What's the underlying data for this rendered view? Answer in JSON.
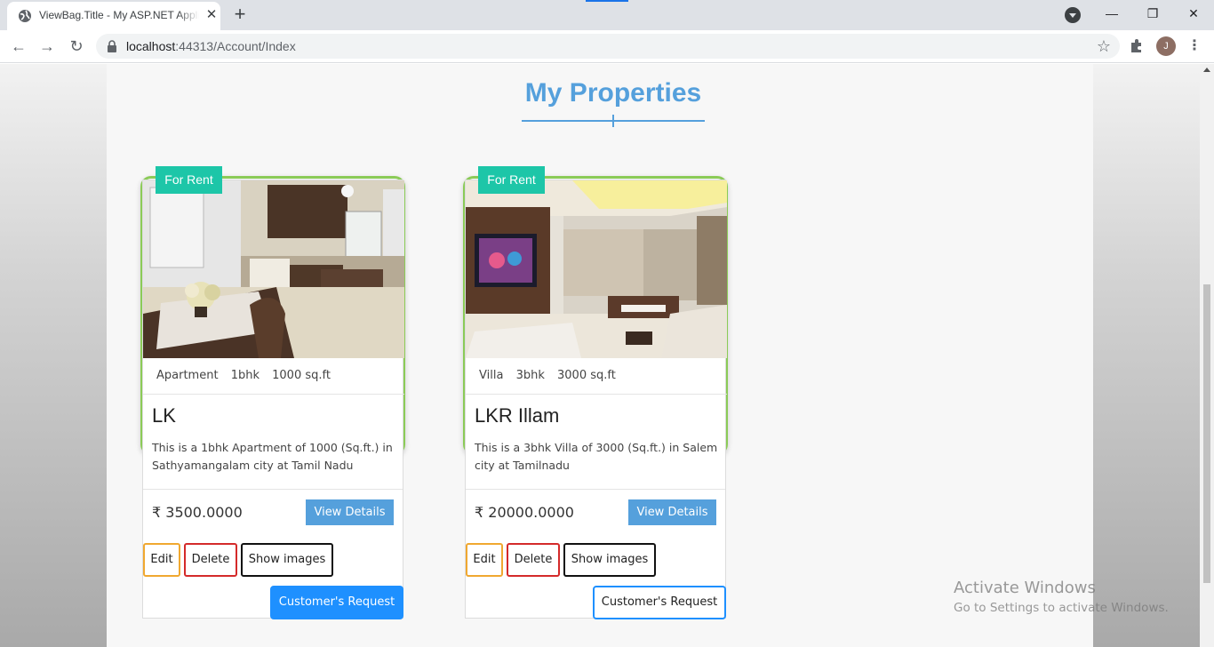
{
  "browser": {
    "tab_title": "ViewBag.Title - My ASP.NET Application",
    "tab_close": "✕",
    "new_tab": "+",
    "url_host": "localhost",
    "url_path": ":44313/Account/Index",
    "avatar_letter": "J",
    "window": {
      "minimize": "—",
      "restore": "❐",
      "close": "✕"
    },
    "nav": {
      "back": "←",
      "forward": "→",
      "reload": "↻"
    },
    "star": "☆",
    "menu": "⋮"
  },
  "page": {
    "title": "My Properties",
    "accent_color": "#55a0dc"
  },
  "properties": [
    {
      "badge": "For Rent",
      "type": "Apartment",
      "bhk": "1bhk",
      "area": "1000 sq.ft",
      "name": "LK",
      "description": "This is a 1bhk Apartment of 1000 (Sq.ft.) in Sathyamangalam city at Tamil Nadu",
      "price": "₹ 3500.0000",
      "view_label": "View Details",
      "edit_label": "Edit",
      "delete_label": "Delete",
      "images_label": "Show images",
      "request_label": "Customer's Request",
      "request_style": "filled"
    },
    {
      "badge": "For Rent",
      "type": "Villa",
      "bhk": "3bhk",
      "area": "3000 sq.ft",
      "name": "LKR Illam",
      "description": "This is a 3bhk Villa of 3000 (Sq.ft.) in Salem city at Tamilnadu",
      "price": "₹ 20000.0000",
      "view_label": "View Details",
      "edit_label": "Edit",
      "delete_label": "Delete",
      "images_label": "Show images",
      "request_label": "Customer's Request",
      "request_style": "outline"
    }
  ],
  "watermark": {
    "line1": "Activate Windows",
    "line2": "Go to Settings to activate Windows."
  }
}
